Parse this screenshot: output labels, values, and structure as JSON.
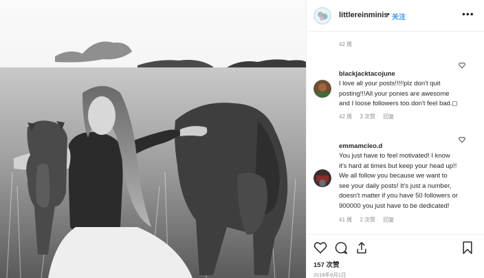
{
  "post": {
    "author": {
      "username": "littlereinminis",
      "separator": "•",
      "follow_label": "关注"
    },
    "more_icon": "more-options-icon",
    "caption_time": "42 周",
    "comments": [
      {
        "author": "blackjacktacojune",
        "text": "I love all your posts!!!!!plz don't quit posting!!!All your ponies are awesome and I loose followers too.don't feel bad.◻",
        "time": "42 周",
        "likes": "3 次赞",
        "reply": "回复",
        "avatar_color": "#7a5c3a"
      },
      {
        "author": "emmamcleo.d",
        "text": "You just have to feel motivated! I know it's hard at times but keep your head up!! We all follow you because we want to see your daily posts! It's just a number, doesn't matter if you have 50 followers or 900000 you just have to be dedicated!",
        "time": "41 周",
        "likes": "2 次赞",
        "reply": "回复",
        "avatar_color": "#5a4a4a"
      }
    ],
    "likes_count": "157 次赞",
    "date": "2018年8月1日",
    "colors": {
      "link_blue": "#3897f0",
      "text": "#262626",
      "muted": "#8e8e8e",
      "border": "#efefef"
    }
  }
}
